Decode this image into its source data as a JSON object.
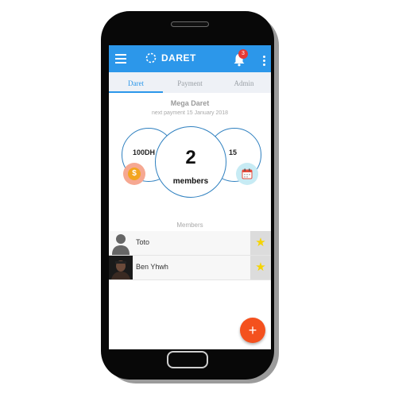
{
  "appbar": {
    "title": "DARET",
    "notification_count": "3"
  },
  "tabs": [
    {
      "label": "Daret",
      "active": true
    },
    {
      "label": "Payment",
      "active": false
    },
    {
      "label": "Admin",
      "active": false
    }
  ],
  "group": {
    "name": "Mega Daret",
    "next_payment": "next payment 15 January 2018",
    "amount": "100DH",
    "days": "15",
    "member_count": "2",
    "member_count_label": "members"
  },
  "members": {
    "section_label": "Members",
    "items": [
      {
        "name": "Toto",
        "avatar": "person-icon",
        "favorite": true
      },
      {
        "name": "Ben Yhwh",
        "avatar": "photo",
        "favorite": true
      }
    ]
  },
  "fab": {
    "label": "+"
  },
  "colors": {
    "primary": "#2c97ea",
    "accent": "#f4511e",
    "star": "#f5d400"
  }
}
